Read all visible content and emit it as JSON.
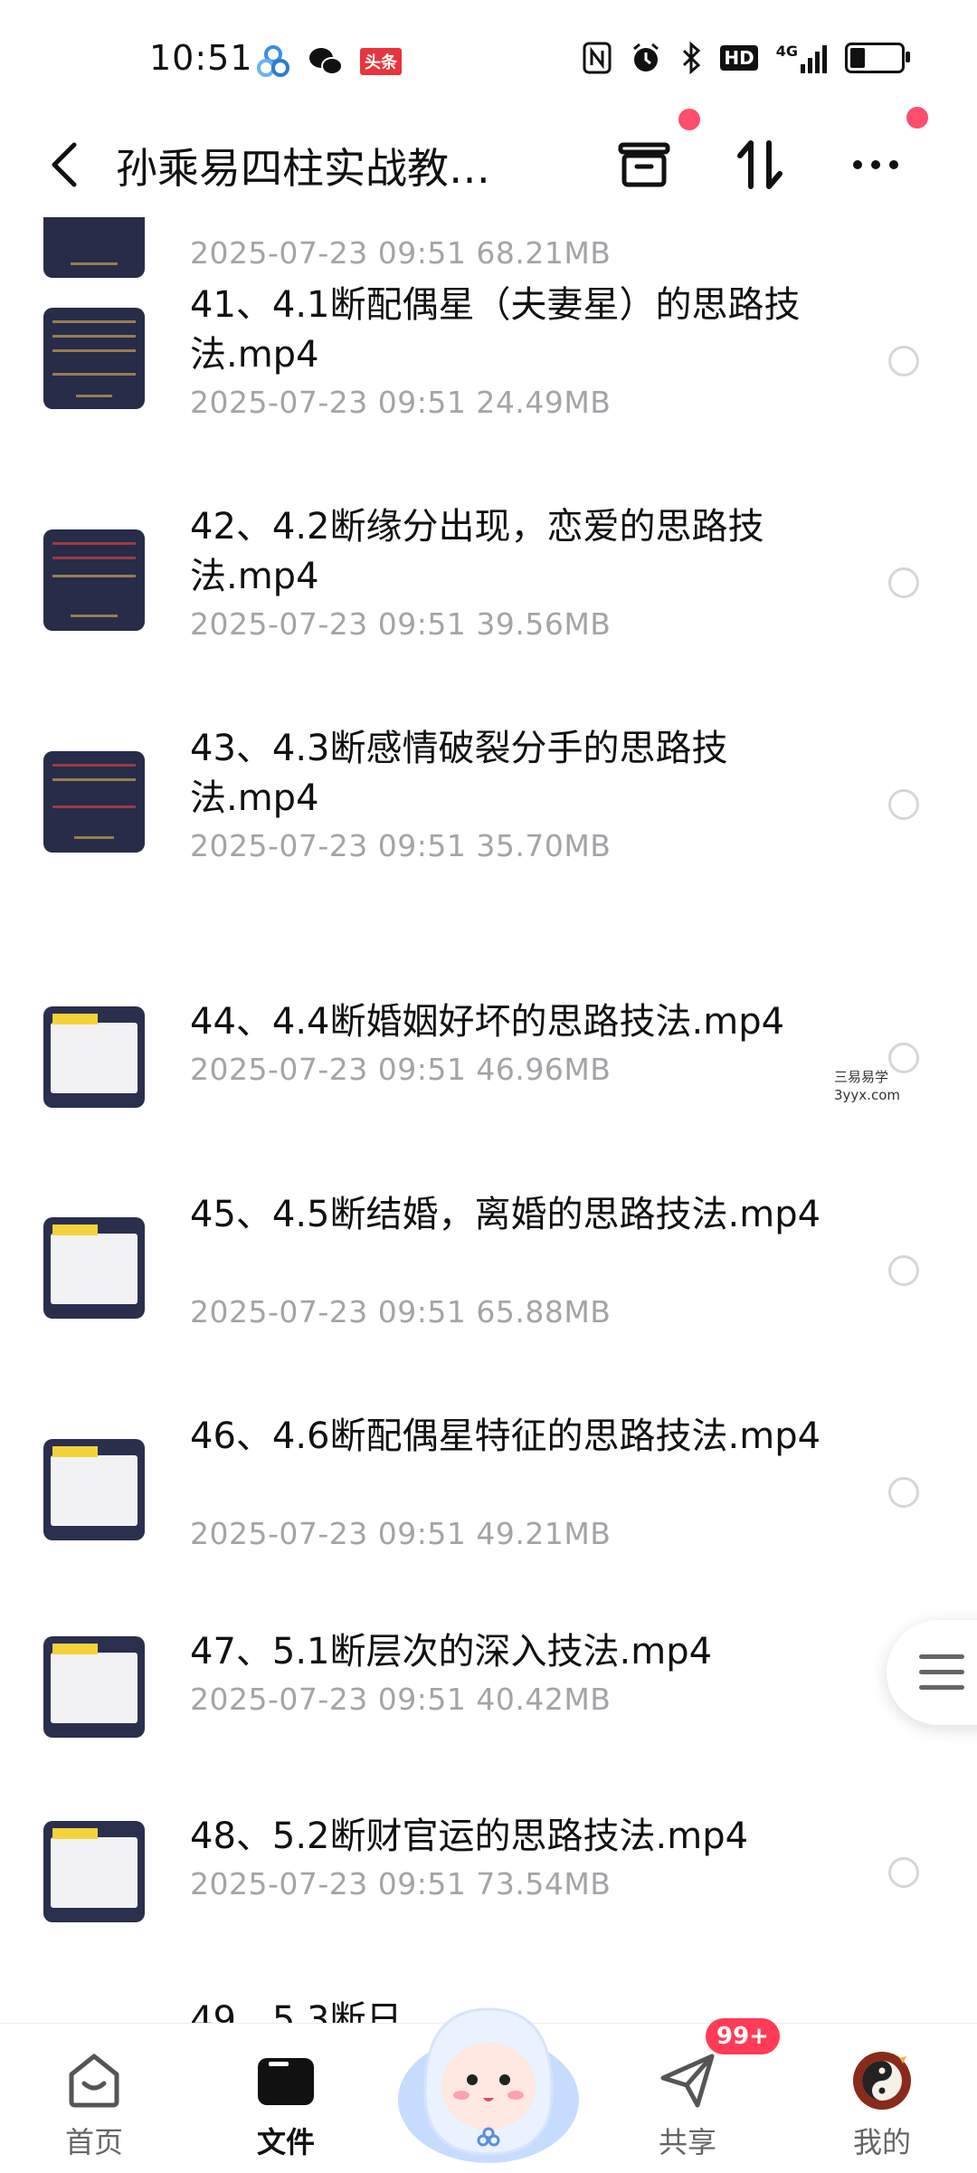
{
  "status_bar": {
    "time": "10:51",
    "left_icons": [
      "app-icon",
      "wechat-icon",
      "toutiao-icon"
    ],
    "toutiao_label": "头条",
    "right_icons": [
      "nfc-icon",
      "alarm-icon",
      "bluetooth-icon",
      "hd-icon",
      "signal-4g-icon",
      "battery-icon"
    ],
    "network": "4G",
    "hd": "HD",
    "battery_level": 0.3
  },
  "nav": {
    "title": "孙乘易四柱实战教…",
    "icons": [
      "back-icon",
      "archive-icon",
      "sort-icon",
      "more-icon"
    ]
  },
  "files": [
    {
      "name": "",
      "meta": "2025-07-23  09:51  68.21MB"
    },
    {
      "name": "41、4.1断配偶星（夫妻星）的思路技法.mp4",
      "meta": "2025-07-23  09:51  24.49MB"
    },
    {
      "name": "42、4.2断缘分出现，恋爱的思路技法.mp4",
      "meta": "2025-07-23  09:51  39.56MB"
    },
    {
      "name": "43、4.3断感情破裂分手的思路技法.mp4",
      "meta": "2025-07-23  09:51  35.70MB"
    },
    {
      "name": "44、4.4断婚姻好坏的思路技法.mp4",
      "meta": "2025-07-23  09:51  46.96MB"
    },
    {
      "name": "45、4.5断结婚，离婚的思路技法.mp4",
      "meta": "2025-07-23  09:51  65.88MB"
    },
    {
      "name": "46、4.6断配偶星特征的思路技法.mp4",
      "meta": "2025-07-23  09:51  49.21MB"
    },
    {
      "name": "47、5.1断层次的深入技法.mp4",
      "meta": "2025-07-23  09:51  40.42MB"
    },
    {
      "name": "48、5.2断财官运的思路技法.mp4",
      "meta": "2025-07-23  09:51  73.54MB"
    },
    {
      "name": "49、5.3断日",
      "meta": ""
    }
  ],
  "watermark": {
    "line1": "三易易学",
    "line2": "3yyx.com"
  },
  "tabs": [
    {
      "label": "首页",
      "icon": "home-icon"
    },
    {
      "label": "文件",
      "icon": "folder-icon"
    },
    {
      "label": "",
      "icon": "mascot-icon"
    },
    {
      "label": "共享",
      "icon": "share-icon"
    },
    {
      "label": "我的",
      "icon": "avatar-icon"
    }
  ],
  "share_badge": "99+",
  "colors": {
    "accent_red": "#ff4d6d",
    "badge_red": "#ff3b57",
    "meta_gray": "#a4a4a8",
    "thumb_navy": "#272c48"
  }
}
